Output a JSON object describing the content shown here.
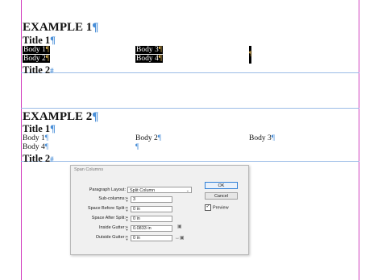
{
  "doc": {
    "example1": {
      "heading": "EXAMPLE 1",
      "title1": "Title 1",
      "body1": "Body 1",
      "body2": "Body 2",
      "body3": "Body 3",
      "body4": "Body 4",
      "title2": "Title 2"
    },
    "example2": {
      "heading": "EXAMPLE 2",
      "title1": "Title 1",
      "body1": "Body 1",
      "body2": "Body 2",
      "body3": "Body 3",
      "body4": "Body 4",
      "title2": "Title 2"
    },
    "pilcrow": "¶",
    "end_mark": "#"
  },
  "dialog": {
    "title": "Span Columns",
    "paragraph_layout_label": "Paragraph Layout:",
    "paragraph_layout_value": "Split Column",
    "subcolumns_label": "Sub-columns:",
    "subcolumns_value": "3",
    "space_before_label": "Space Before Split:",
    "space_before_value": "0 in",
    "space_after_label": "Space After Split:",
    "space_after_value": "0 in",
    "inside_gutter_label": "Inside Gutter:",
    "inside_gutter_value": "0.0833 in",
    "outside_gutter_label": "Outside Gutter:",
    "outside_gutter_value": "0 in",
    "ok_label": "OK",
    "cancel_label": "Cancel",
    "preview_label": "Preview",
    "preview_checked": true
  },
  "colors": {
    "margin_guide": "#d23fbf",
    "column_guide": "#6f9fd6",
    "selection": "#000000",
    "pilcrow": "#4a8fd8"
  }
}
